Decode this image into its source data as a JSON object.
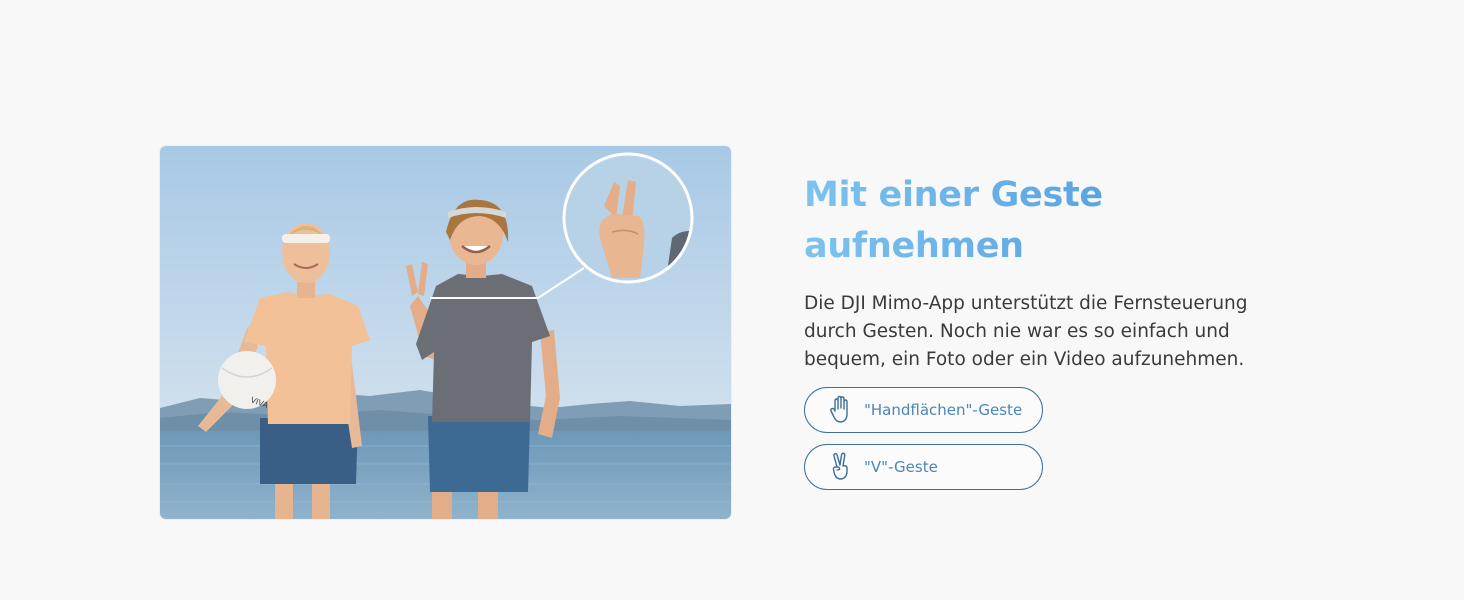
{
  "section": {
    "headline_line1": "Mit einer Geste",
    "headline_line2": "aufnehmen",
    "description": "Die DJI Mimo-App unterstützt die Fernsteuerung durch Gesten. Noch nie war es so einfach und bequem, ein Foto oder ein Video aufzunehmen."
  },
  "gestures": [
    {
      "label": "\"Handflächen\"-Geste",
      "icon": "palm-hand-icon"
    },
    {
      "label": "\"V\"-Geste",
      "icon": "v-sign-hand-icon"
    }
  ],
  "photo": {
    "ball_text": "VIVA"
  },
  "colors": {
    "background": "#f8f8f8",
    "headline_start": "#7cc3ef",
    "headline_end": "#4f8fd3",
    "body_text": "#3a3a3a",
    "button_border": "#3d6f9b",
    "button_text": "#4a86b8"
  }
}
